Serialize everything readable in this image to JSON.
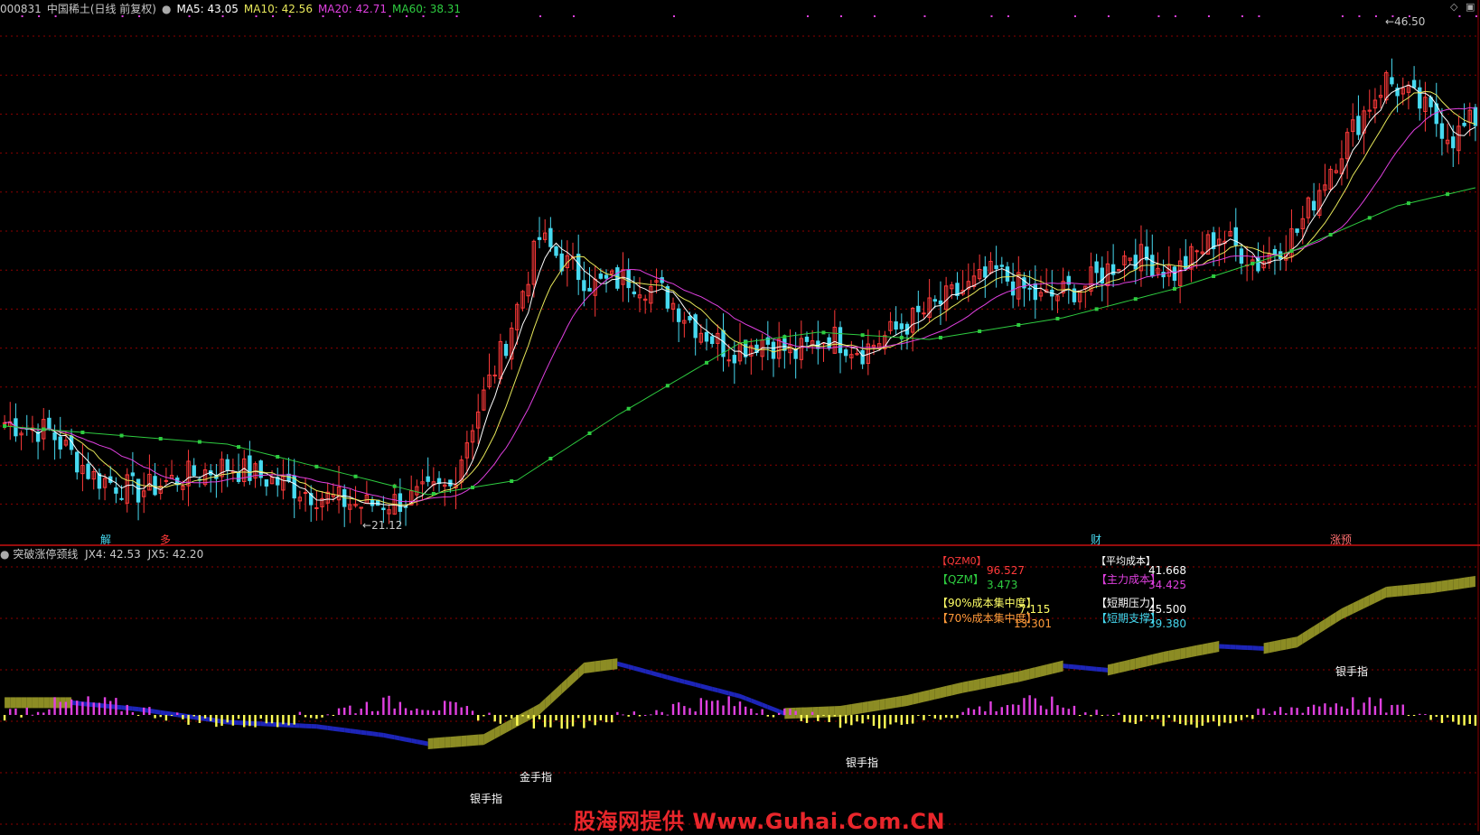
{
  "header": {
    "code": "000831",
    "name": "中国稀土(日线 前复权)",
    "settings_icon": "gear-circle-icon",
    "ma5": "MA5: 43.05",
    "ma10": "MA10: 42.56",
    "ma20": "MA20: 42.71",
    "ma60": "MA60: 38.31"
  },
  "colors": {
    "background": "#000000",
    "up": "#ff3a3a",
    "down": "#47d9f0",
    "ma5": "#ffffff",
    "ma10": "#e8e85a",
    "ma20": "#e040e0",
    "ma60": "#2ecc40",
    "grid": "#8b0000",
    "band_up": "#8c8c24",
    "band_down": "#1d25b8"
  },
  "markers": {
    "high_label": "46.50",
    "low_label": "21.12",
    "event_jie": "解",
    "event_duo": "多",
    "event_caibao": "财",
    "event_zhangting": "涨预"
  },
  "indicator": {
    "title": "突破涨停颈线",
    "jx4": "JX4: 42.53",
    "jx5": "JX5: 42.20",
    "panel": {
      "qzm0_label": "【QZM0】",
      "qzm0_value": "96.527",
      "qzm_label": "【QZM】",
      "qzm_value": "3.473",
      "avg_cost_label": "【平均成本】",
      "avg_cost_value": "41.668",
      "main_cost_label": "【主力成本】",
      "main_cost_value": "34.425",
      "c90_label": "【90%成本集中度】",
      "c90_value": "7.115",
      "c70_label": "【70%成本集中度】",
      "c70_value": "13.301",
      "press_label": "【短期压力】",
      "press_value": "45.500",
      "support_label": "【短期支撑】",
      "support_value": "39.380"
    },
    "signals": {
      "s1": "银手指",
      "s2": "金手指",
      "s3": "银手指",
      "s4": "银手指"
    }
  },
  "watermark": "股海网提供 Www.Guhai.Com.CN",
  "chart_data": [
    {
      "type": "candlestick",
      "title": "中国稀土(日线 前复权)",
      "price_range": [
        20,
        48
      ],
      "high_marker": 46.5,
      "low_marker": 21.12,
      "close_series": [
        [
          0,
          26.0
        ],
        [
          8,
          25.5
        ],
        [
          16,
          23.0
        ],
        [
          24,
          22.2
        ],
        [
          32,
          23.0
        ],
        [
          40,
          23.6
        ],
        [
          48,
          22.8
        ],
        [
          56,
          22.0
        ],
        [
          64,
          21.4
        ],
        [
          72,
          21.7
        ],
        [
          80,
          22.4
        ],
        [
          84,
          26.0
        ],
        [
          90,
          30.5
        ],
        [
          96,
          36.2
        ],
        [
          100,
          35.0
        ],
        [
          106,
          33.6
        ],
        [
          112,
          34.0
        ],
        [
          118,
          33.2
        ],
        [
          124,
          31.4
        ],
        [
          130,
          30.0
        ],
        [
          136,
          30.6
        ],
        [
          142,
          29.8
        ],
        [
          148,
          30.8
        ],
        [
          154,
          30.0
        ],
        [
          162,
          31.5
        ],
        [
          170,
          33.0
        ],
        [
          178,
          34.3
        ],
        [
          186,
          32.8
        ],
        [
          194,
          33.6
        ],
        [
          202,
          35.4
        ],
        [
          210,
          34.3
        ],
        [
          218,
          36.4
        ],
        [
          225,
          34.8
        ],
        [
          232,
          36.6
        ],
        [
          238,
          40.2
        ],
        [
          244,
          43.2
        ],
        [
          248,
          45.0
        ],
        [
          254,
          43.6
        ],
        [
          260,
          41.8
        ],
        [
          264,
          42.8
        ]
      ],
      "ma_series": {
        "MA5": 43.05,
        "MA10": 42.56,
        "MA20": 42.71,
        "MA60": 38.31,
        "ma60_path": [
          [
            0,
            25.8
          ],
          [
            40,
            24.8
          ],
          [
            76,
            22.0
          ],
          [
            92,
            22.8
          ],
          [
            110,
            26.4
          ],
          [
            132,
            30.4
          ],
          [
            146,
            31.0
          ],
          [
            166,
            30.6
          ],
          [
            190,
            31.8
          ],
          [
            210,
            33.4
          ],
          [
            232,
            35.6
          ],
          [
            250,
            38.0
          ],
          [
            264,
            39.0
          ]
        ]
      }
    },
    {
      "type": "area",
      "title": "突破涨停颈线",
      "series": [
        {
          "name": "JX4",
          "last": 42.53
        },
        {
          "name": "JX5",
          "last": 42.2
        }
      ],
      "band_path": [
        [
          0,
          0.09
        ],
        [
          12,
          0.09
        ],
        [
          24,
          0.06
        ],
        [
          40,
          0.0
        ],
        [
          56,
          -0.02
        ],
        [
          68,
          -0.06
        ],
        [
          76,
          -0.1
        ],
        [
          86,
          -0.08
        ],
        [
          96,
          0.06
        ],
        [
          104,
          0.25
        ],
        [
          110,
          0.27
        ],
        [
          120,
          0.2
        ],
        [
          132,
          0.12
        ],
        [
          140,
          0.04
        ],
        [
          150,
          0.05
        ],
        [
          162,
          0.1
        ],
        [
          172,
          0.16
        ],
        [
          182,
          0.21
        ],
        [
          190,
          0.26
        ],
        [
          198,
          0.24
        ],
        [
          208,
          0.3
        ],
        [
          218,
          0.35
        ],
        [
          226,
          0.34
        ],
        [
          232,
          0.37
        ],
        [
          240,
          0.5
        ],
        [
          248,
          0.6
        ],
        [
          256,
          0.62
        ],
        [
          264,
          0.65
        ]
      ]
    }
  ]
}
